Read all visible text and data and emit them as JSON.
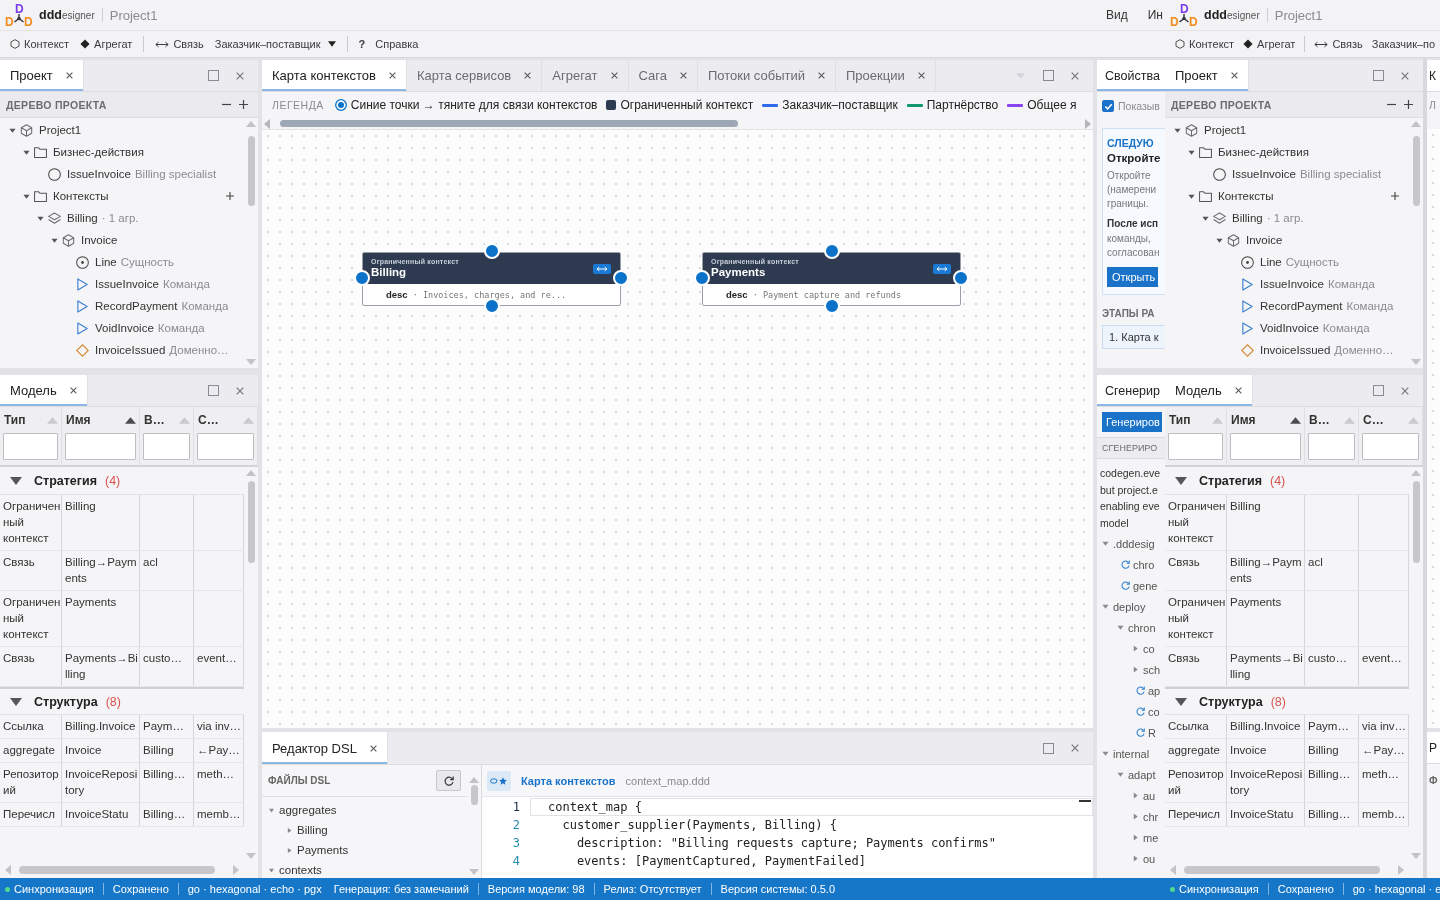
{
  "windows": [
    {
      "header": {
        "logo_letters": [
          "D",
          "D",
          "D"
        ],
        "brand": "**ddd**esigner",
        "project": "Project1",
        "menu": [
          "Вид",
          "Ин"
        ]
      },
      "toolbar": [
        {
          "kind": "context",
          "label": "Контекст"
        },
        {
          "kind": "aggregate",
          "label": "Агрегат"
        },
        {
          "kind": "separator"
        },
        {
          "kind": "relation",
          "label": "Связь"
        },
        {
          "kind": "pattern",
          "label": "Заказчик–поставщик",
          "dropdown": true
        },
        {
          "kind": "separator"
        },
        {
          "kind": "help",
          "glyph": "?",
          "label": "Справка"
        }
      ],
      "project_panel": {
        "tab": {
          "label": "Проект",
          "selected": true
        },
        "heading": "ДЕРЕВО ПРОЕКТА",
        "tree": [
          {
            "kind": "project",
            "name": "Project1",
            "expanded": true,
            "children": [
              {
                "kind": "folder",
                "name": "Бизнес-действия",
                "expanded": true,
                "children": [
                  {
                    "kind": "action",
                    "name": "IssueInvoice",
                    "note": "Billing specialist"
                  }
                ]
              },
              {
                "kind": "folder",
                "name": "Контексты",
                "expanded": true,
                "add_button": true,
                "children": [
                  {
                    "kind": "context",
                    "name": "Billing",
                    "note": "· 1 агр.",
                    "expanded": true,
                    "children": [
                      {
                        "kind": "aggregate",
                        "name": "Invoice",
                        "expanded": true,
                        "children": [
                          {
                            "kind": "entity",
                            "name": "Line",
                            "note": "Сущность"
                          },
                          {
                            "kind": "command",
                            "name": "IssueInvoice",
                            "note": "Команда"
                          },
                          {
                            "kind": "command",
                            "name": "RecordPayment",
                            "note": "Команда"
                          },
                          {
                            "kind": "command",
                            "name": "VoidInvoice",
                            "note": "Команда"
                          },
                          {
                            "kind": "event",
                            "name": "InvoiceIssued",
                            "note": "Доменно…"
                          }
                        ]
                      }
                    ]
                  }
                ]
              }
            ]
          }
        ]
      },
      "model_panel": {
        "tab": {
          "label": "Модель",
          "selected": true
        },
        "columns": [
          {
            "label": "Тип",
            "sorted": false
          },
          {
            "label": "Имя",
            "sorted": true
          },
          {
            "label": "В…",
            "sorted": false
          },
          {
            "label": "С…",
            "sorted": false
          }
        ],
        "groups": [
          {
            "name": "Стратегия",
            "count": "(4)",
            "expanded": true,
            "rows": [
              [
                "Ограниченный контекст",
                "Billing"
              ],
              [
                "Связь",
                "Billing→Payments",
                "acl"
              ],
              [
                "Ограниченный контекст",
                "Payments"
              ],
              [
                "Связь",
                "Payments→Billing",
                "custo…",
                "event…"
              ]
            ]
          },
          {
            "name": "Структура",
            "count": "(8)",
            "expanded": true,
            "rows": [
              [
                "Ссылка",
                "Billing.Invoice",
                "Paym…",
                "via inv…"
              ],
              [
                "aggregate",
                "Invoice",
                "Billing",
                "←Pay…"
              ],
              [
                "Репозиторий",
                "InvoiceRepository",
                "Billing…",
                "meth…"
              ],
              [
                "Перечисл",
                "InvoiceStatu",
                "Billing…",
                "memb…"
              ]
            ]
          }
        ]
      },
      "status_bar": [
        {
          "kind": "sync",
          "color": "#4fd88e",
          "text": "Синхронизация"
        },
        {
          "kind": "separator"
        },
        {
          "kind": "text",
          "text": "Сохранено"
        },
        {
          "kind": "separator"
        },
        {
          "kind": "text",
          "text": "go · hexagonal · echo · pgx"
        },
        {
          "kind": "text",
          "text": "Генерация: без замечаний"
        },
        {
          "kind": "separator"
        },
        {
          "kind": "text",
          "text": "Версия модели: 98"
        },
        {
          "kind": "separator"
        },
        {
          "kind": "text",
          "text": "Релиз: Отсутствует"
        },
        {
          "kind": "separator"
        },
        {
          "kind": "text",
          "text": "Версия системы: 0.5.0"
        }
      ]
    },
    {
      "header": {
        "logo_letters": [
          "D",
          "D",
          "D"
        ],
        "brand": "**ddd**esigner",
        "project": "Project1"
      },
      "toolbar": [
        {
          "kind": "context",
          "label": "Контекст"
        },
        {
          "kind": "aggregate",
          "label": "Агрегат"
        },
        {
          "kind": "separator"
        },
        {
          "kind": "relation",
          "label": "Связь"
        },
        {
          "kind": "pattern",
          "label": "Заказчик–по"
        }
      ],
      "project_panel": {
        "tab": {
          "label": "Проект",
          "selected": true
        },
        "heading": "ДЕРЕВО ПРОЕКТА",
        "tree": [
          {
            "kind": "project",
            "name": "Project1",
            "expanded": true,
            "children": [
              {
                "kind": "folder",
                "name": "Бизнес-действия",
                "expanded": true,
                "children": [
                  {
                    "kind": "action",
                    "name": "IssueInvoice",
                    "note": "Billing specialist"
                  }
                ]
              },
              {
                "kind": "folder",
                "name": "Контексты",
                "expanded": true,
                "add_button": true,
                "children": [
                  {
                    "kind": "context",
                    "name": "Billing",
                    "note": "· 1 агр.",
                    "expanded": true,
                    "children": [
                      {
                        "kind": "aggregate",
                        "name": "Invoice",
                        "expanded": true,
                        "children": [
                          {
                            "kind": "entity",
                            "name": "Line",
                            "note": "Сущность"
                          },
                          {
                            "kind": "command",
                            "name": "IssueInvoice",
                            "note": "Команда"
                          },
                          {
                            "kind": "command",
                            "name": "RecordPayment",
                            "note": "Команда"
                          },
                          {
                            "kind": "command",
                            "name": "VoidInvoice",
                            "note": "Команда"
                          },
                          {
                            "kind": "event",
                            "name": "InvoiceIssued",
                            "note": "Доменно…"
                          }
                        ]
                      }
                    ]
                  }
                ]
              }
            ]
          }
        ]
      },
      "model_panel": {
        "tab": {
          "label": "Модель",
          "selected": true
        },
        "columns": [
          {
            "label": "Тип",
            "sorted": false
          },
          {
            "label": "Имя",
            "sorted": true
          },
          {
            "label": "В…",
            "sorted": false
          },
          {
            "label": "С…",
            "sorted": false
          }
        ],
        "groups": [
          {
            "name": "Стратегия",
            "count": "(4)",
            "expanded": true,
            "rows": [
              [
                "Ограниченный контекст",
                "Billing"
              ],
              [
                "Связь",
                "Billing→Payments",
                "acl"
              ],
              [
                "Ограниченный контекст",
                "Payments"
              ],
              [
                "Связь",
                "Payments→Billing",
                "custo…",
                "event…"
              ]
            ]
          },
          {
            "name": "Структура",
            "count": "(8)",
            "expanded": true,
            "rows": [
              [
                "Ссылка",
                "Billing.Invoice",
                "Paym…",
                "via inv…"
              ],
              [
                "aggregate",
                "Invoice",
                "Billing",
                "←Pay…"
              ],
              [
                "Репозиторий",
                "InvoiceRepository",
                "Billing…",
                "meth…"
              ],
              [
                "Перечисл",
                "InvoiceStatu",
                "Billing…",
                "memb…"
              ]
            ]
          }
        ]
      },
      "status_bar": [
        {
          "kind": "sync",
          "color": "#4fd88e",
          "text": "Синхронизация"
        },
        {
          "kind": "separator"
        },
        {
          "kind": "text",
          "text": "Сохранено"
        },
        {
          "kind": "separator"
        },
        {
          "kind": "text",
          "text": "go · hexagonal · e"
        }
      ]
    }
  ],
  "map_panel": {
    "tabs": [
      {
        "label": "Карта контекстов",
        "selected": true
      },
      {
        "label": "Карта сервисов",
        "selected": false
      },
      {
        "label": "Агрегат",
        "selected": false
      },
      {
        "label": "Сага",
        "selected": false
      },
      {
        "label": "Потоки событий",
        "selected": false
      },
      {
        "label": "Проекции",
        "selected": false
      }
    ],
    "legend_title": "ЛЕГЕНДА",
    "legend": [
      {
        "kind": "handle",
        "color": "#0b72c9",
        "text": "Синие точки → тяните для связи контекстов"
      },
      {
        "kind": "block",
        "color": "#2d3a4f",
        "text": "Ограниченный контекст"
      },
      {
        "kind": "line",
        "color": "#2f6be8",
        "text": "Заказчик–поставщик"
      },
      {
        "kind": "line",
        "color": "#13976e",
        "text": "Партнёрство"
      },
      {
        "kind": "line",
        "color": "#8a44f0",
        "text": "Общее я"
      }
    ],
    "nodes": [
      {
        "kind_label": "Ограниченный контекст",
        "name": "Billing",
        "field": "desc",
        "value": "· Invoices, charges, and re..."
      },
      {
        "kind_label": "Ограниченный контекст",
        "name": "Payments",
        "field": "desc",
        "value": "· Payment capture and refunds"
      }
    ]
  },
  "dsl_panel": {
    "tab": {
      "label": "Редактор DSL",
      "selected": true
    },
    "files_heading": "ФАЙЛЫ DSL",
    "files": [
      {
        "name": "aggregates",
        "expanded": true,
        "children": [
          {
            "name": "Billing",
            "expanded": false
          },
          {
            "name": "Payments",
            "expanded": false
          }
        ]
      },
      {
        "name": "contexts",
        "expanded": true
      }
    ],
    "editor_title": "Карта контекстов",
    "file_name": "context_map.ddd",
    "lines": [
      {
        "number": "1",
        "code": "context_map {",
        "current": true
      },
      {
        "number": "2",
        "code": "  customer_supplier(Payments, Billing) {",
        "current": false
      },
      {
        "number": "3",
        "code": "    description: \"Billing requests capture; Payments confirms\"",
        "current": false
      },
      {
        "number": "4",
        "code": "    events: [PaymentCaptured, PaymentFailed]",
        "current": false
      }
    ]
  },
  "side_panel": {
    "top": {
      "tab": {
        "label": "Свойства",
        "selected": true
      },
      "checkbox": {
        "label": "Показыв",
        "checked": true
      },
      "card": {
        "kicker": "СЛЕДУЮ",
        "title": "Откройте",
        "text_lines": [
          "Откройте",
          "(намерени",
          "границы."
        ],
        "subtitle": "После исп",
        "sub_lines": [
          "команды,",
          "согласован"
        ],
        "button": "Открыть"
      },
      "steps_heading": "ЭТАПЫ РА",
      "steps": [
        {
          "label": "1. Карта к",
          "selected": true
        }
      ]
    },
    "bottom": {
      "tab": {
        "label": "Сгенерир",
        "selected": true
      },
      "button": "Генериров",
      "heading": "СГЕНЕРИРО",
      "text_lines": [
        "codegen.eve",
        "but project.e",
        "enabling eve",
        "model"
      ],
      "tree": [
        {
          "kind": "folder",
          "name": ".dddesig",
          "expanded": true,
          "children": [
            {
              "kind": "generated",
              "name": "chro"
            },
            {
              "kind": "generated",
              "name": "gene"
            }
          ]
        },
        {
          "kind": "folder",
          "name": "deploy",
          "expanded": true,
          "children": [
            {
              "kind": "folder",
              "name": "chron",
              "expanded": true,
              "children": [
                {
                  "kind": "folder",
                  "name": "co",
                  "expanded": false
                },
                {
                  "kind": "folder",
                  "name": "sch",
                  "expanded": false
                },
                {
                  "kind": "generated",
                  "name": "ap"
                },
                {
                  "kind": "generated",
                  "name": "co"
                },
                {
                  "kind": "generated",
                  "name": "R"
                }
              ]
            }
          ]
        },
        {
          "kind": "folder",
          "name": "internal",
          "expanded": true,
          "children": [
            {
              "kind": "folder",
              "name": "adapt",
              "expanded": true,
              "children": [
                {
                  "kind": "folder",
                  "name": "au",
                  "expanded": false
                },
                {
                  "kind": "folder",
                  "name": "chr",
                  "expanded": false
                },
                {
                  "kind": "folder",
                  "name": "me",
                  "expanded": false
                },
                {
                  "kind": "folder",
                  "name": "ou",
                  "expanded": false
                }
              ]
            }
          ]
        }
      ]
    }
  },
  "copy_edge": {
    "tab": "К",
    "legend": "Л",
    "editor_tab": "Р",
    "files_heading": "Ф"
  }
}
